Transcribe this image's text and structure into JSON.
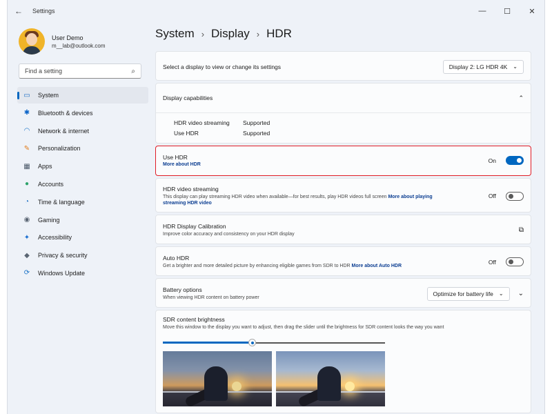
{
  "window": {
    "title": "Settings"
  },
  "user": {
    "name": "User Demo",
    "email": "m__lab@outlook.com"
  },
  "search": {
    "placeholder": "Find a setting"
  },
  "nav": [
    {
      "label": "System",
      "icon": "monitor-icon",
      "glyph": "▭",
      "color": "#1f6fc5",
      "active": true
    },
    {
      "label": "Bluetooth & devices",
      "icon": "bluetooth-icon",
      "glyph": "✱",
      "color": "#0a64c8"
    },
    {
      "label": "Network & internet",
      "icon": "wifi-icon",
      "glyph": "◠",
      "color": "#1a73c8"
    },
    {
      "label": "Personalization",
      "icon": "brush-icon",
      "glyph": "✎",
      "color": "#e07b1a"
    },
    {
      "label": "Apps",
      "icon": "apps-icon",
      "glyph": "▦",
      "color": "#4a5868"
    },
    {
      "label": "Accounts",
      "icon": "person-icon",
      "glyph": "●",
      "color": "#2ea36b"
    },
    {
      "label": "Time & language",
      "icon": "globe-clock-icon",
      "glyph": "◔",
      "color": "#1f73c5"
    },
    {
      "label": "Gaming",
      "icon": "gamepad-icon",
      "glyph": "◉",
      "color": "#5a6573"
    },
    {
      "label": "Accessibility",
      "icon": "accessibility-icon",
      "glyph": "✦",
      "color": "#1a6fd0"
    },
    {
      "label": "Privacy & security",
      "icon": "shield-icon",
      "glyph": "◆",
      "color": "#5a6573"
    },
    {
      "label": "Windows Update",
      "icon": "update-icon",
      "glyph": "⟳",
      "color": "#1a73c8"
    }
  ],
  "breadcrumb": [
    "System",
    "Display",
    "HDR"
  ],
  "display_select": {
    "label": "Select a display to view or change its settings",
    "value": "Display 2: LG HDR 4K"
  },
  "capabilities": {
    "title": "Display capabilities",
    "rows": [
      {
        "name": "HDR video streaming",
        "value": "Supported"
      },
      {
        "name": "Use HDR",
        "value": "Supported"
      }
    ]
  },
  "use_hdr": {
    "label": "Use HDR",
    "link": "More about HDR",
    "state": "On",
    "on": true
  },
  "hdr_streaming": {
    "label": "HDR video streaming",
    "desc": "This display can play streaming HDR video when available—for best results, play HDR videos full screen",
    "link": "More about playing streaming HDR video",
    "state": "Off"
  },
  "calibration": {
    "label": "HDR Display Calibration",
    "desc": "Improve color accuracy and consistency on your HDR display"
  },
  "auto_hdr": {
    "label": "Auto HDR",
    "desc": "Get a brighter and more detailed picture by enhancing eligible games from SDR to HDR",
    "link": "More about Auto HDR",
    "state": "Off"
  },
  "battery": {
    "label": "Battery options",
    "desc": "When viewing HDR content on battery power",
    "value": "Optimize for battery life"
  },
  "sdr_brightness": {
    "label": "SDR content brightness",
    "desc": "Move this window to the display you want to adjust, then drag the slider until the brightness for SDR content looks the way you want",
    "level_fraction": 0.4
  }
}
